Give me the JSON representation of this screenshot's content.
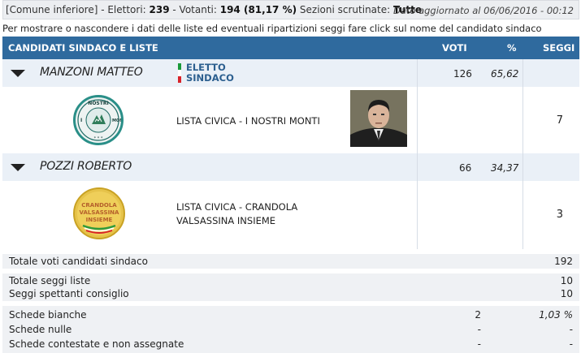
{
  "topbar": {
    "area": "[Comune inferiore]",
    "elettori_label": " - Elettori: ",
    "elettori": "239",
    "votanti_label": " - Votanti: ",
    "votanti": "194 (81,17 %)",
    "sezioni_label": " Sezioni scrutinate: ",
    "sezioni": "Tutte",
    "updated": "Dato aggiornato al 06/06/2016 - 00:12"
  },
  "hint": "Per mostrare o nascondere i dati delle liste ed eventuali ripartizioni seggi fare click sul nome del candidato sindaco",
  "table_header": {
    "candidati": "CANDIDATI SINDACO E LISTE",
    "voti": "VOTI",
    "pct": "%",
    "seggi": "SEGGI"
  },
  "candidates": [
    {
      "name": "MANZONI MATTEO",
      "votes": "126",
      "pct": "65,62",
      "elected_line1": "ELETTO",
      "elected_line2": "SINDACO",
      "list_name": "LISTA CIVICA - I NOSTRI MONTI",
      "list_logo_text": "I NOSTRI MONTI",
      "seats": "7"
    },
    {
      "name": "POZZI ROBERTO",
      "votes": "66",
      "pct": "34,37",
      "list_name_line1": "LISTA CIVICA - CRANDOLA",
      "list_name_line2": "VALSASSINA INSIEME",
      "list_logo_text1": "CRANDOLA",
      "list_logo_text2": "VALSASSINA",
      "list_logo_text3": "INSIEME",
      "seats": "3"
    }
  ],
  "summary": {
    "totale_voti_label": "Totale voti candidati sindaco",
    "totale_voti": "192",
    "totale_seggi_label": "Totale seggi liste",
    "totale_seggi": "10",
    "seggi_consiglio_label": "Seggi spettanti consiglio",
    "seggi_consiglio": "10",
    "bianche_label": "Schede bianche",
    "bianche": "2",
    "bianche_pct": "1,03 %",
    "nulle_label": "Schede nulle",
    "nulle": "-",
    "nulle_pct": "-",
    "contestate_label": "Schede contestate e non assegnate",
    "contestate": "-",
    "contestate_pct": "-"
  },
  "colors": {
    "header_bg": "#2f6a9e",
    "candidate_row_bg": "#eaf0f7",
    "elected_text": "#2c5f8f"
  }
}
